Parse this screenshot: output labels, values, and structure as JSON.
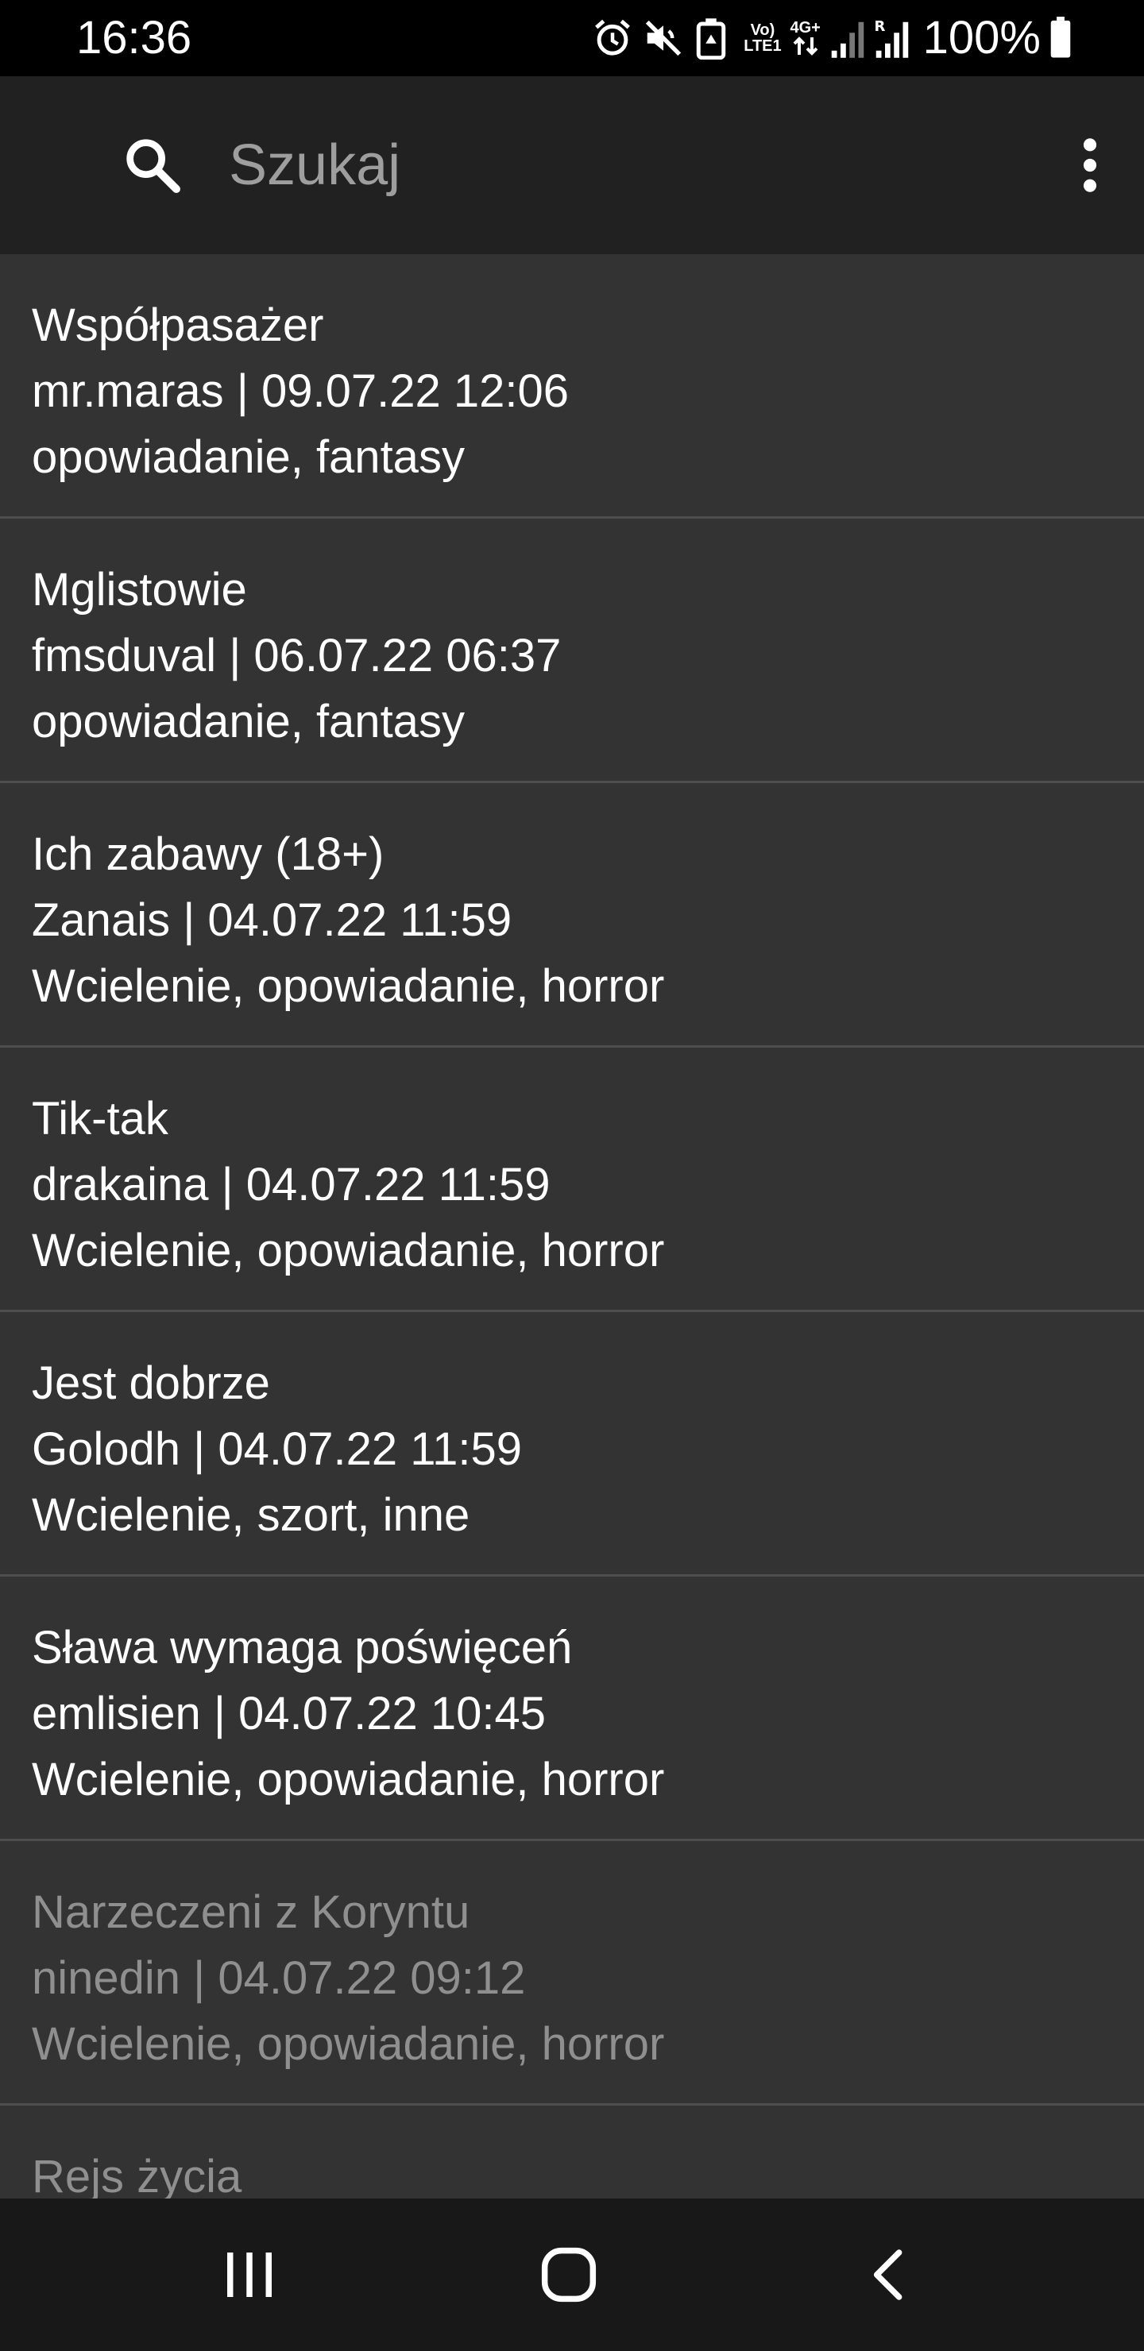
{
  "status_bar": {
    "time": "16:36",
    "battery": "100%",
    "network_top": "Vo)",
    "network_bottom": "LTE1",
    "data_type": "4G+",
    "roaming": "R",
    "icons": [
      "alarm-icon",
      "mute-icon",
      "recycle-icon",
      "volte-icon",
      "data-arrows-icon",
      "signal-icon",
      "signal-roaming-icon",
      "battery-icon"
    ]
  },
  "search": {
    "placeholder": "Szukaj",
    "value": ""
  },
  "toolbar": {
    "icons": [
      "search-icon",
      "more-vert-icon"
    ]
  },
  "stories": [
    {
      "title": "Współpasażer",
      "meta": "mr.maras | 09.07.22 12:06",
      "tags": "opowiadanie, fantasy",
      "read": false
    },
    {
      "title": "Mglistowie",
      "meta": "fmsduval | 06.07.22 06:37",
      "tags": "opowiadanie, fantasy",
      "read": false
    },
    {
      "title": "Ich zabawy (18+)",
      "meta": "Zanais | 04.07.22 11:59",
      "tags": "Wcielenie, opowiadanie, horror",
      "read": false
    },
    {
      "title": "Tik-tak",
      "meta": "drakaina | 04.07.22 11:59",
      "tags": "Wcielenie, opowiadanie, horror",
      "read": false
    },
    {
      "title": "Jest dobrze",
      "meta": "Golodh | 04.07.22 11:59",
      "tags": "Wcielenie, szort, inne",
      "read": false
    },
    {
      "title": "Sława wymaga poświęceń",
      "meta": "emlisien | 04.07.22 10:45",
      "tags": "Wcielenie, opowiadanie, horror",
      "read": false
    },
    {
      "title": "Narzeczeni z Koryntu",
      "meta": "ninedin | 04.07.22 09:12",
      "tags": "Wcielenie, opowiadanie, horror",
      "read": true
    },
    {
      "title": "Rejs życia",
      "meta": "",
      "tags": "",
      "read": true
    }
  ],
  "nav_bar": {
    "icons": [
      "recent-apps-icon",
      "home-icon",
      "back-icon"
    ]
  },
  "colors": {
    "background": "#333333",
    "toolbar": "#212121",
    "status_bar": "#000000",
    "nav_bar": "#181818",
    "text_primary": "#ffffff",
    "text_read": "#8f8f8f",
    "divider": "#4e4e4e"
  }
}
